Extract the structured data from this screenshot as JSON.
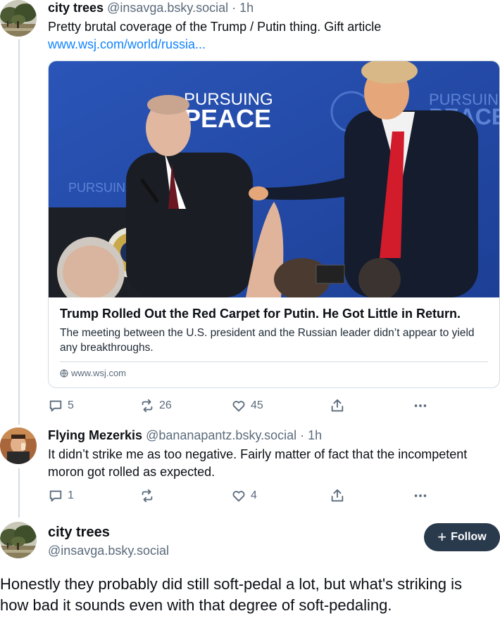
{
  "post1": {
    "display_name": "city trees",
    "handle": "@insavga.bsky.social",
    "separator": "·",
    "time": "1h",
    "text": "Pretty brutal coverage of the Trump / Putin thing. Gift article",
    "link": "www.wsj.com/world/russia...",
    "card": {
      "image_sign_text_1": "PURSUING",
      "image_sign_text_2": "PEACE",
      "title": "Trump Rolled Out the Red Carpet for Putin. He Got Little in Return.",
      "description": "The meeting between the U.S. president and the Russian leader didn’t appear to yield any breakthroughs.",
      "domain": "www.wsj.com"
    },
    "actions": {
      "replies": "5",
      "reposts": "26",
      "likes": "45"
    }
  },
  "post2": {
    "display_name": "Flying Mezerkis",
    "handle": "@bananapantz.bsky.social",
    "separator": "·",
    "time": "1h",
    "text": "It didn’t strike me as too negative. Fairly matter of fact that the incompetent moron got rolled as expected.",
    "actions": {
      "replies": "1",
      "reposts": "",
      "likes": "4"
    }
  },
  "main_post": {
    "display_name": "city trees",
    "handle": "@insavga.bsky.social",
    "follow_label": "Follow",
    "text": "Honestly they probably did still soft-pedal a lot, but what's striking is how bad it sounds even with that degree of soft-pedaling."
  },
  "colors": {
    "link": "#1083fe",
    "muted": "#5b6b7c",
    "follow_bg": "#2a3a4d",
    "border": "#d4dbe2"
  }
}
